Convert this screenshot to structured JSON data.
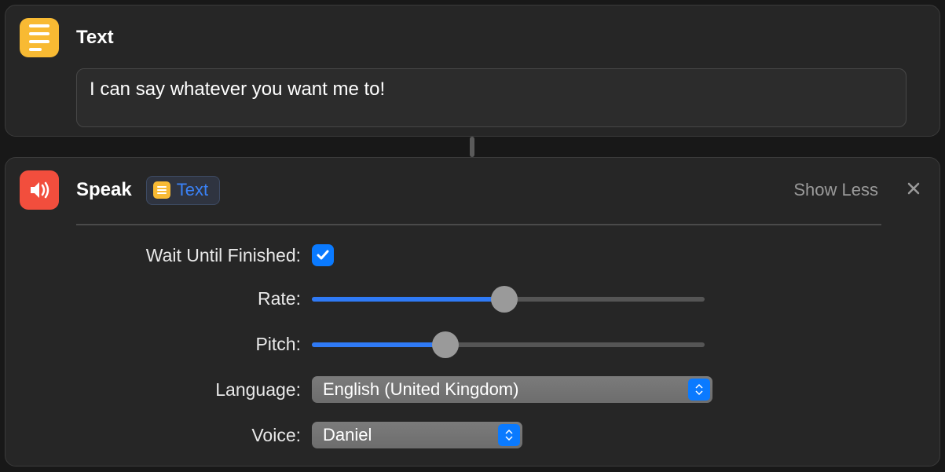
{
  "text_card": {
    "title": "Text",
    "value": "I can say whatever you want me to!"
  },
  "speak_card": {
    "title": "Speak",
    "token_label": "Text",
    "show_less_label": "Show Less",
    "options": {
      "wait_label": "Wait Until Finished:",
      "wait_checked": true,
      "rate_label": "Rate:",
      "rate_percent": 49,
      "pitch_label": "Pitch:",
      "pitch_percent": 34,
      "language_label": "Language:",
      "language_value": "English (United Kingdom)",
      "voice_label": "Voice:",
      "voice_value": "Daniel"
    }
  }
}
